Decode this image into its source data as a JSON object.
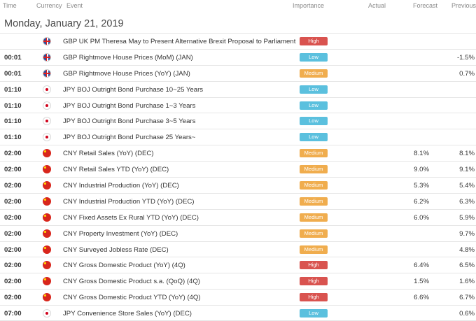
{
  "headers": {
    "time": "Time",
    "currency": "Currency",
    "event": "Event",
    "importance": "Importance",
    "actual": "Actual",
    "forecast": "Forecast",
    "previous": "Previous"
  },
  "date_label": "Monday, January 21, 2019",
  "colors": {
    "high": "#d9534f",
    "low": "#5bc0de",
    "medium": "#f0ad4e"
  },
  "events": [
    {
      "time": "",
      "flag": "gb",
      "flag_icon": "uk-flag-icon",
      "event": "GBP UK PM Theresa May to Present Alternative Brexit Proposal to Parliament",
      "importance": "High",
      "actual": "",
      "forecast": "",
      "previous": ""
    },
    {
      "time": "00:01",
      "flag": "gb",
      "flag_icon": "uk-flag-icon",
      "event": "GBP Rightmove House Prices (MoM) (JAN)",
      "importance": "Low",
      "actual": "",
      "forecast": "",
      "previous": "-1.5%"
    },
    {
      "time": "00:01",
      "flag": "gb",
      "flag_icon": "uk-flag-icon",
      "event": "GBP Rightmove House Prices (YoY) (JAN)",
      "importance": "Medium",
      "actual": "",
      "forecast": "",
      "previous": "0.7%"
    },
    {
      "time": "01:10",
      "flag": "jp",
      "flag_icon": "japan-flag-icon",
      "event": "JPY BOJ Outright Bond Purchase 10~25 Years",
      "importance": "Low",
      "actual": "",
      "forecast": "",
      "previous": ""
    },
    {
      "time": "01:10",
      "flag": "jp",
      "flag_icon": "japan-flag-icon",
      "event": "JPY BOJ Outright Bond Purchase 1~3 Years",
      "importance": "Low",
      "actual": "",
      "forecast": "",
      "previous": ""
    },
    {
      "time": "01:10",
      "flag": "jp",
      "flag_icon": "japan-flag-icon",
      "event": "JPY BOJ Outright Bond Purchase 3~5 Years",
      "importance": "Low",
      "actual": "",
      "forecast": "",
      "previous": ""
    },
    {
      "time": "01:10",
      "flag": "jp",
      "flag_icon": "japan-flag-icon",
      "event": "JPY BOJ Outright Bond Purchase 25 Years~",
      "importance": "Low",
      "actual": "",
      "forecast": "",
      "previous": ""
    },
    {
      "time": "02:00",
      "flag": "cn",
      "flag_icon": "china-flag-icon",
      "event": "CNY Retail Sales (YoY) (DEC)",
      "importance": "Medium",
      "actual": "",
      "forecast": "8.1%",
      "previous": "8.1%"
    },
    {
      "time": "02:00",
      "flag": "cn",
      "flag_icon": "china-flag-icon",
      "event": "CNY Retail Sales YTD (YoY) (DEC)",
      "importance": "Medium",
      "actual": "",
      "forecast": "9.0%",
      "previous": "9.1%"
    },
    {
      "time": "02:00",
      "flag": "cn",
      "flag_icon": "china-flag-icon",
      "event": "CNY Industrial Production (YoY) (DEC)",
      "importance": "Medium",
      "actual": "",
      "forecast": "5.3%",
      "previous": "5.4%"
    },
    {
      "time": "02:00",
      "flag": "cn",
      "flag_icon": "china-flag-icon",
      "event": "CNY Industrial Production YTD (YoY) (DEC)",
      "importance": "Medium",
      "actual": "",
      "forecast": "6.2%",
      "previous": "6.3%"
    },
    {
      "time": "02:00",
      "flag": "cn",
      "flag_icon": "china-flag-icon",
      "event": "CNY Fixed Assets Ex Rural YTD (YoY) (DEC)",
      "importance": "Medium",
      "actual": "",
      "forecast": "6.0%",
      "previous": "5.9%"
    },
    {
      "time": "02:00",
      "flag": "cn",
      "flag_icon": "china-flag-icon",
      "event": "CNY Property Investment (YoY) (DEC)",
      "importance": "Medium",
      "actual": "",
      "forecast": "",
      "previous": "9.7%"
    },
    {
      "time": "02:00",
      "flag": "cn",
      "flag_icon": "china-flag-icon",
      "event": "CNY Surveyed Jobless Rate (DEC)",
      "importance": "Medium",
      "actual": "",
      "forecast": "",
      "previous": "4.8%"
    },
    {
      "time": "02:00",
      "flag": "cn",
      "flag_icon": "china-flag-icon",
      "event": "CNY Gross Domestic Product (YoY) (4Q)",
      "importance": "High",
      "actual": "",
      "forecast": "6.4%",
      "previous": "6.5%"
    },
    {
      "time": "02:00",
      "flag": "cn",
      "flag_icon": "china-flag-icon",
      "event": "CNY Gross Domestic Product s.a. (QoQ) (4Q)",
      "importance": "High",
      "actual": "",
      "forecast": "1.5%",
      "previous": "1.6%"
    },
    {
      "time": "02:00",
      "flag": "cn",
      "flag_icon": "china-flag-icon",
      "event": "CNY Gross Domestic Product YTD (YoY) (4Q)",
      "importance": "High",
      "actual": "",
      "forecast": "6.6%",
      "previous": "6.7%"
    },
    {
      "time": "07:00",
      "flag": "jp",
      "flag_icon": "japan-flag-icon",
      "event": "JPY Convenience Store Sales (YoY) (DEC)",
      "importance": "Low",
      "actual": "",
      "forecast": "",
      "previous": "0.6%"
    }
  ]
}
